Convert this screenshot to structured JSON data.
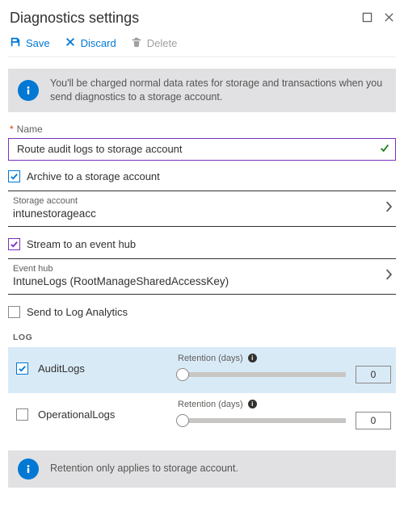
{
  "header": {
    "title": "Diagnostics settings"
  },
  "toolbar": {
    "save_label": "Save",
    "discard_label": "Discard",
    "delete_label": "Delete"
  },
  "info1": "You'll be charged normal data rates for storage and transactions when you send diagnostics to a storage account.",
  "name_field": {
    "label": "Name",
    "value": "Route audit logs to storage account"
  },
  "opts": {
    "archive_label": "Archive to a storage account",
    "stream_label": "Stream to an event hub",
    "send_la_label": "Send to Log Analytics"
  },
  "storage_picker": {
    "label": "Storage account",
    "value": "intunestorageacc"
  },
  "eventhub_picker": {
    "label": "Event hub",
    "value": "IntuneLogs (RootManageSharedAccessKey)"
  },
  "log_section_label": "LOG",
  "retention_label": "Retention (days)",
  "logs": [
    {
      "name": "AuditLogs",
      "checked": true,
      "retention": "0"
    },
    {
      "name": "OperationalLogs",
      "checked": false,
      "retention": "0"
    }
  ],
  "info2": "Retention only applies to storage account."
}
